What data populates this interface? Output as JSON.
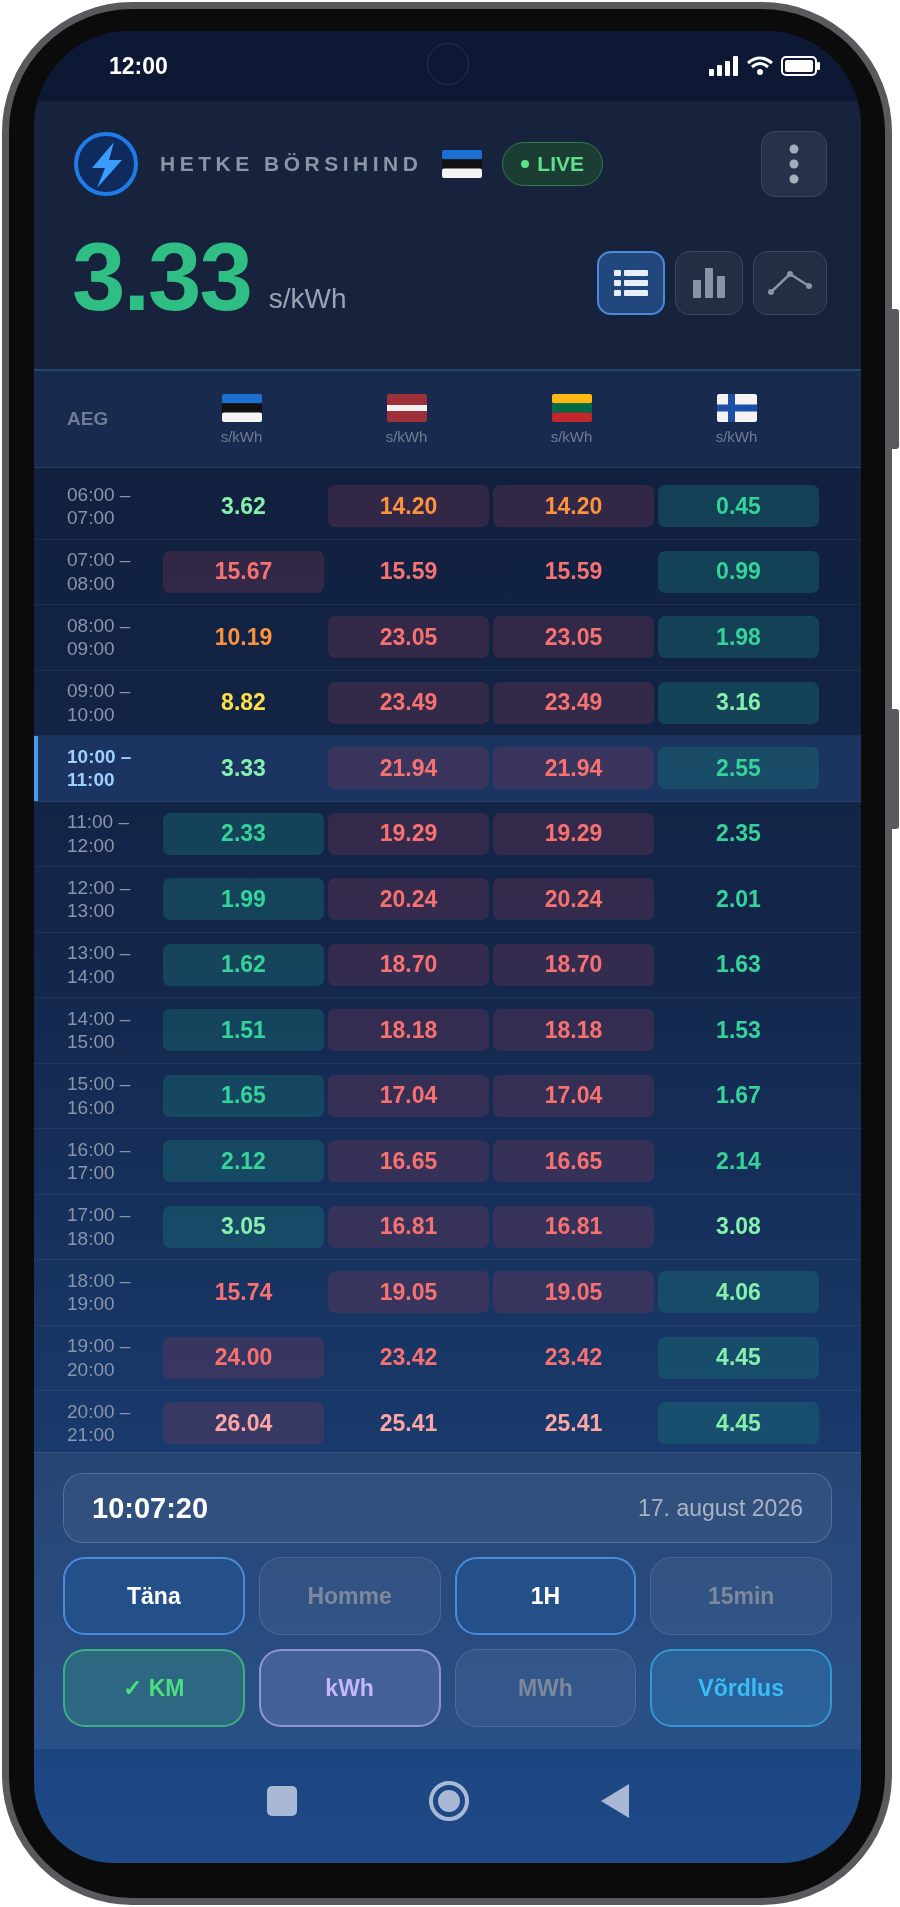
{
  "status_bar": {
    "time": "12:00"
  },
  "header": {
    "title": "HETKE BÖRSIHIND",
    "flag": {
      "kind": "estonia"
    },
    "live_badge": "LIVE",
    "price": "3.33",
    "unit": "s/kWh",
    "views": [
      {
        "kind": "list",
        "selected": true
      },
      {
        "kind": "bars",
        "selected": false
      },
      {
        "kind": "line",
        "selected": false
      }
    ]
  },
  "table": {
    "time_heading": "AEG",
    "columns": [
      {
        "kind": "estonia",
        "unit": "s/kWh"
      },
      {
        "kind": "latvia",
        "unit": "s/kWh"
      },
      {
        "kind": "lithuania",
        "unit": "s/kWh"
      },
      {
        "kind": "finland",
        "unit": "s/kWh"
      }
    ],
    "rows": [
      {
        "time": "06:00 – 07:00",
        "selected": false,
        "cells": [
          {
            "value": "3.62",
            "kind": "plain",
            "color": "#86efac"
          },
          {
            "value": "14.20",
            "kind": "high",
            "color": "#fb923c"
          },
          {
            "value": "14.20",
            "kind": "high",
            "color": "#fb923c"
          },
          {
            "value": "0.45",
            "kind": "low",
            "color": "#34d399"
          }
        ]
      },
      {
        "time": "07:00 – 08:00",
        "selected": false,
        "cells": [
          {
            "value": "15.67",
            "kind": "high",
            "color": "#f87171"
          },
          {
            "value": "15.59",
            "kind": "plain",
            "color": "#f87171"
          },
          {
            "value": "15.59",
            "kind": "plain",
            "color": "#f87171"
          },
          {
            "value": "0.99",
            "kind": "low",
            "color": "#34d399"
          }
        ]
      },
      {
        "time": "08:00 – 09:00",
        "selected": false,
        "cells": [
          {
            "value": "10.19",
            "kind": "plain",
            "color": "#fb923c"
          },
          {
            "value": "23.05",
            "kind": "high",
            "color": "#f87171"
          },
          {
            "value": "23.05",
            "kind": "high",
            "color": "#f87171"
          },
          {
            "value": "1.98",
            "kind": "low",
            "color": "#34d399"
          }
        ]
      },
      {
        "time": "09:00 – 10:00",
        "selected": false,
        "cells": [
          {
            "value": "8.82",
            "kind": "plain",
            "color": "#fde047"
          },
          {
            "value": "23.49",
            "kind": "high",
            "color": "#f87171"
          },
          {
            "value": "23.49",
            "kind": "high",
            "color": "#f87171"
          },
          {
            "value": "3.16",
            "kind": "low",
            "color": "#86efac"
          }
        ]
      },
      {
        "time": "10:00 – 11:00",
        "selected": true,
        "cells": [
          {
            "value": "3.33",
            "kind": "plain",
            "color": "#86efac"
          },
          {
            "value": "21.94",
            "kind": "high",
            "color": "#f87171"
          },
          {
            "value": "21.94",
            "kind": "high",
            "color": "#f87171"
          },
          {
            "value": "2.55",
            "kind": "low",
            "color": "#34d399"
          }
        ]
      },
      {
        "time": "11:00 – 12:00",
        "selected": false,
        "cells": [
          {
            "value": "2.33",
            "kind": "low",
            "color": "#34d399"
          },
          {
            "value": "19.29",
            "kind": "high",
            "color": "#f87171"
          },
          {
            "value": "19.29",
            "kind": "high",
            "color": "#f87171"
          },
          {
            "value": "2.35",
            "kind": "plain",
            "color": "#34d399"
          }
        ]
      },
      {
        "time": "12:00 – 13:00",
        "selected": false,
        "cells": [
          {
            "value": "1.99",
            "kind": "low",
            "color": "#34d399"
          },
          {
            "value": "20.24",
            "kind": "high",
            "color": "#f87171"
          },
          {
            "value": "20.24",
            "kind": "high",
            "color": "#f87171"
          },
          {
            "value": "2.01",
            "kind": "plain",
            "color": "#34d399"
          }
        ]
      },
      {
        "time": "13:00 – 14:00",
        "selected": false,
        "cells": [
          {
            "value": "1.62",
            "kind": "low",
            "color": "#34d399"
          },
          {
            "value": "18.70",
            "kind": "high",
            "color": "#f87171"
          },
          {
            "value": "18.70",
            "kind": "high",
            "color": "#f87171"
          },
          {
            "value": "1.63",
            "kind": "plain",
            "color": "#34d399"
          }
        ]
      },
      {
        "time": "14:00 – 15:00",
        "selected": false,
        "cells": [
          {
            "value": "1.51",
            "kind": "low",
            "color": "#34d399"
          },
          {
            "value": "18.18",
            "kind": "high",
            "color": "#f87171"
          },
          {
            "value": "18.18",
            "kind": "high",
            "color": "#f87171"
          },
          {
            "value": "1.53",
            "kind": "plain",
            "color": "#34d399"
          }
        ]
      },
      {
        "time": "15:00 – 16:00",
        "selected": false,
        "cells": [
          {
            "value": "1.65",
            "kind": "low",
            "color": "#34d399"
          },
          {
            "value": "17.04",
            "kind": "high",
            "color": "#f87171"
          },
          {
            "value": "17.04",
            "kind": "high",
            "color": "#f87171"
          },
          {
            "value": "1.67",
            "kind": "plain",
            "color": "#34d399"
          }
        ]
      },
      {
        "time": "16:00 – 17:00",
        "selected": false,
        "cells": [
          {
            "value": "2.12",
            "kind": "low",
            "color": "#34d399"
          },
          {
            "value": "16.65",
            "kind": "high",
            "color": "#f87171"
          },
          {
            "value": "16.65",
            "kind": "high",
            "color": "#f87171"
          },
          {
            "value": "2.14",
            "kind": "plain",
            "color": "#34d399"
          }
        ]
      },
      {
        "time": "17:00 – 18:00",
        "selected": false,
        "cells": [
          {
            "value": "3.05",
            "kind": "low",
            "color": "#86efac"
          },
          {
            "value": "16.81",
            "kind": "high",
            "color": "#f87171"
          },
          {
            "value": "16.81",
            "kind": "high",
            "color": "#f87171"
          },
          {
            "value": "3.08",
            "kind": "plain",
            "color": "#86efac"
          }
        ]
      },
      {
        "time": "18:00 – 19:00",
        "selected": false,
        "cells": [
          {
            "value": "15.74",
            "kind": "plain",
            "color": "#f87171"
          },
          {
            "value": "19.05",
            "kind": "high",
            "color": "#f87171"
          },
          {
            "value": "19.05",
            "kind": "high",
            "color": "#f87171"
          },
          {
            "value": "4.06",
            "kind": "low",
            "color": "#86efac"
          }
        ]
      },
      {
        "time": "19:00 – 20:00",
        "selected": false,
        "cells": [
          {
            "value": "24.00",
            "kind": "high",
            "color": "#f87171"
          },
          {
            "value": "23.42",
            "kind": "plain",
            "color": "#f87171"
          },
          {
            "value": "23.42",
            "kind": "plain",
            "color": "#f87171"
          },
          {
            "value": "4.45",
            "kind": "low",
            "color": "#86efac"
          }
        ]
      },
      {
        "time": "20:00 – 21:00",
        "selected": false,
        "cells": [
          {
            "value": "26.04",
            "kind": "high",
            "color": "#fca5a5"
          },
          {
            "value": "25.41",
            "kind": "plain",
            "color": "#fca5a5"
          },
          {
            "value": "25.41",
            "kind": "plain",
            "color": "#fca5a5"
          },
          {
            "value": "4.45",
            "kind": "low",
            "color": "#86efac"
          }
        ]
      }
    ]
  },
  "clock": {
    "time": "10:07:20",
    "date": "17. august 2026"
  },
  "period_buttons": [
    {
      "label": "Täna",
      "selected": true
    },
    {
      "label": "Homme",
      "selected": false
    },
    {
      "label": "1H",
      "selected": true
    },
    {
      "label": "15min",
      "selected": false
    }
  ],
  "option_buttons": [
    {
      "label": "✓ KM",
      "selected": true,
      "color": "#4ade80"
    },
    {
      "label": "kWh",
      "selected": true,
      "color": "#c4b5fd"
    },
    {
      "label": "MWh",
      "selected": false
    },
    {
      "label": "Võrdlus",
      "selected": true,
      "color": "#38bdf8"
    }
  ]
}
